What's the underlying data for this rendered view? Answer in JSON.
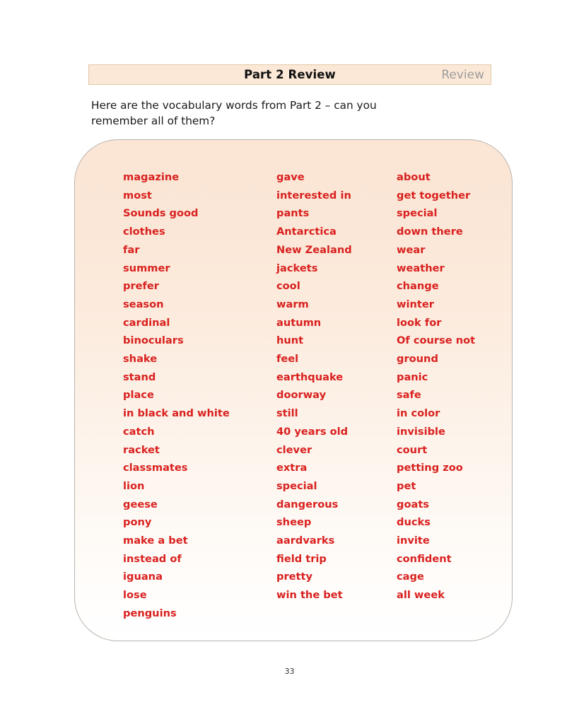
{
  "header": {
    "title": "Part 2 Review",
    "right_label": "Review",
    "background_color": "#fbe8d6",
    "border_color": "#e2c9a9"
  },
  "intro": {
    "text": "Here are the vocabulary words from Part 2 – can you\nremember all of them?"
  },
  "vocab_panel": {
    "accent_color": "#d9211f",
    "background_top_color": "#fbe6d6",
    "background_bottom_color": "#ffffff",
    "border_color": "#b9b3ae",
    "columns": [
      {
        "words": [
          "magazine",
          "most",
          "Sounds good",
          "clothes",
          "far",
          "summer",
          "prefer",
          "season",
          "cardinal",
          "binoculars",
          "shake",
          "stand",
          "place",
          "in black and white",
          "catch",
          "racket",
          "classmates",
          "lion",
          "geese",
          "pony",
          "make a bet",
          "instead of",
          "iguana",
          "lose",
          "penguins"
        ]
      },
      {
        "words": [
          "gave",
          "interested in",
          "pants",
          "Antarctica",
          "New Zealand",
          "jackets",
          "cool",
          "warm",
          "autumn",
          "hunt",
          "feel",
          "earthquake",
          "doorway",
          "still",
          "40 years old",
          "clever",
          "extra",
          "special",
          "dangerous",
          "sheep",
          "aardvarks",
          "field trip",
          "pretty",
          "win the bet"
        ]
      },
      {
        "words": [
          "about",
          "get together",
          "special",
          "down there",
          "wear",
          "weather",
          "change",
          "winter",
          "look for",
          "Of course not",
          "ground",
          "panic",
          "safe",
          "in color",
          "invisible",
          "court",
          "petting zoo",
          "pet",
          "goats",
          "ducks",
          "invite",
          "confident",
          "cage",
          "all week"
        ]
      }
    ]
  },
  "footer": {
    "page_number": "33"
  }
}
